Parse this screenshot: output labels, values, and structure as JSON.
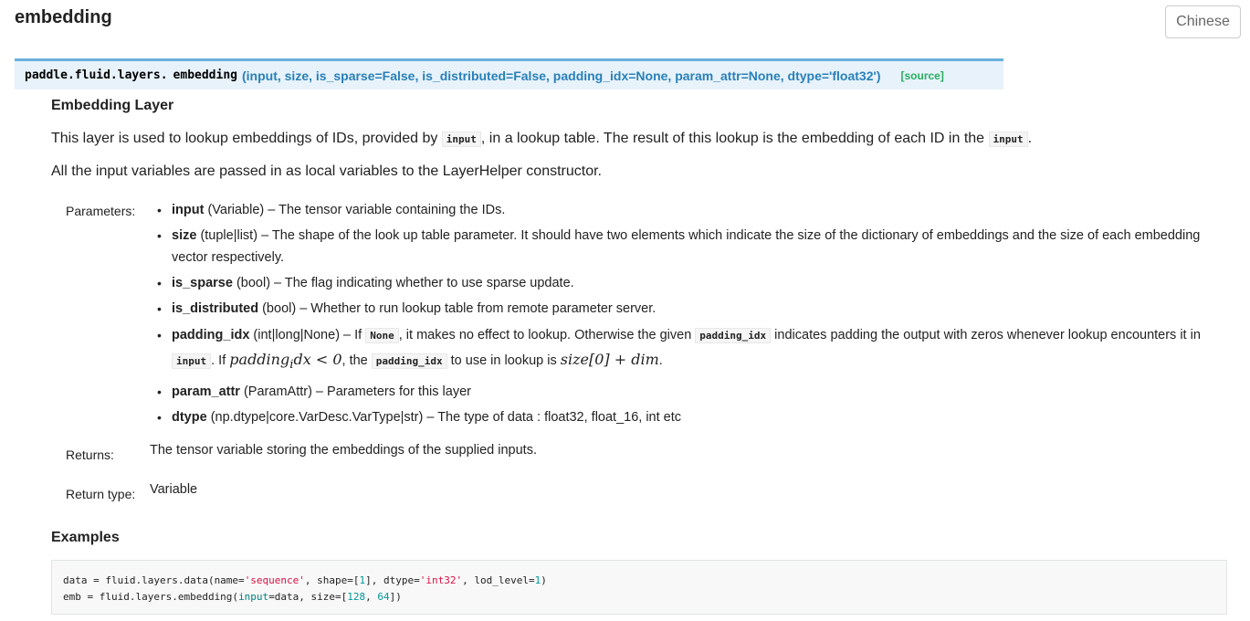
{
  "page": {
    "title": "embedding",
    "language_button": "Chinese"
  },
  "signature": {
    "module": "paddle.fluid.layers.",
    "name": "embedding",
    "params": "(input, size, is_sparse=False, is_distributed=False, padding_idx=None, param_attr=None, dtype='float32')",
    "source_link": "[source]"
  },
  "description": {
    "heading": "Embedding Layer",
    "para1_a": "This layer is used to lookup embeddings of IDs, provided by ",
    "para1_code1": "input",
    "para1_b": ", in a lookup table. The result of this lookup is the embedding of each ID in the ",
    "para1_code2": "input",
    "para1_c": ".",
    "para2": "All the input variables are passed in as local variables to the LayerHelper constructor."
  },
  "parameters": {
    "label": "Parameters:",
    "items": [
      {
        "name": "input",
        "type": " (Variable)",
        "desc": " – The tensor variable containing the IDs."
      },
      {
        "name": "size",
        "type": " (tuple|list)",
        "desc": " – The shape of the look up table parameter. It should have two elements which indicate the size of the dictionary of embeddings and the size of each embedding vector respectively."
      },
      {
        "name": "is_sparse",
        "type": " (bool)",
        "desc": " – The flag indicating whether to use sparse update."
      },
      {
        "name": "is_distributed",
        "type": " (bool)",
        "desc": " – Whether to run lookup table from remote parameter server."
      },
      {
        "name": "padding_idx",
        "type": " (int|long|None)",
        "desc_a": " – If ",
        "code1": "None",
        "desc_b": ", it makes no effect to lookup. Otherwise the given ",
        "code2": "padding_idx",
        "desc_c": " indicates padding the output with zeros whenever lookup encounters it in ",
        "code3": "input",
        "desc_d": ". If ",
        "math1": "padding",
        "math1_sub": "i",
        "math1_rest": "dx < 0",
        "desc_e": ", the ",
        "code4": "padding_idx",
        "desc_f": " to use in lookup is ",
        "math2": "size[0] + dim",
        "desc_g": "."
      },
      {
        "name": "param_attr",
        "type": " (ParamAttr)",
        "desc": " – Parameters for this layer"
      },
      {
        "name": "dtype",
        "type": " (np.dtype|core.VarDesc.VarType|str)",
        "desc": " – The type of data : float32, float_16, int etc"
      }
    ]
  },
  "returns": {
    "label": "Returns:",
    "value": "The tensor variable storing the embeddings of the supplied inputs."
  },
  "return_type": {
    "label": "Return type:",
    "value": "Variable"
  },
  "examples": {
    "heading": "Examples",
    "line1": {
      "a": "data = fluid.layers.data(name=",
      "s1": "'sequence'",
      "b": ", shape=[",
      "n1": "1",
      "c": "], dtype=",
      "s2": "'int32'",
      "d": ", lod_level=",
      "n2": "1",
      "e": ")"
    },
    "line2": {
      "a": "emb = fluid.layers.embedding(",
      "k1": "input",
      "b": "=data, size=[",
      "n1": "128",
      "c": ", ",
      "n2": "64",
      "d": "])"
    }
  },
  "colors": {
    "signature_bg": "#e7f2fa",
    "signature_border": "#6ab0de",
    "param_text": "#2980b9",
    "source_link": "#27ae60"
  }
}
